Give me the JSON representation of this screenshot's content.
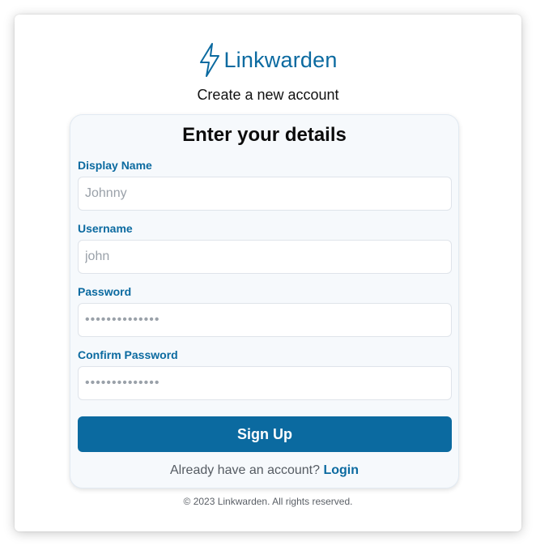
{
  "logo": {
    "text": "Linkwarden"
  },
  "subtitle": "Create a new account",
  "form": {
    "title": "Enter your details",
    "fields": [
      {
        "label": "Display Name",
        "placeholder": "Johnny",
        "value": ""
      },
      {
        "label": "Username",
        "placeholder": "john",
        "value": ""
      },
      {
        "label": "Password",
        "placeholder": "••••••••••••••",
        "value": ""
      },
      {
        "label": "Confirm Password",
        "placeholder": "••••••••••••••",
        "value": ""
      }
    ],
    "submit_label": "Sign Up",
    "login_prompt": "Already have an account?",
    "login_link": "Login"
  },
  "footer": {
    "text": "© 2023 Linkwarden. All rights reserved."
  },
  "colors": {
    "brand": "#0b6aa0",
    "card_background": "#f6f9fc"
  },
  "icons": {
    "logo": "lightning-bolt-icon"
  }
}
